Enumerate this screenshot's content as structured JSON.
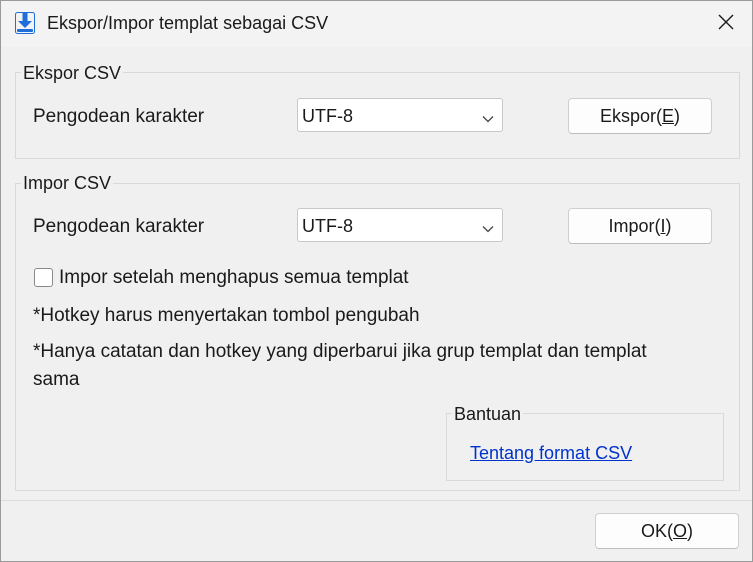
{
  "window": {
    "title": "Ekspor/Impor templat sebagai CSV"
  },
  "icons": {
    "app": "download-arrow-icon",
    "close": "close-icon",
    "dropdown": "chevron-down-icon"
  },
  "export_group": {
    "legend": "Ekspor CSV",
    "encoding_label": "Pengodean karakter",
    "encoding_value": "UTF-8",
    "button_prefix": "Ekspor(",
    "button_accel": "E",
    "button_suffix": ")"
  },
  "import_group": {
    "legend": "Impor CSV",
    "encoding_label": "Pengodean karakter",
    "encoding_value": "UTF-8",
    "button_prefix": "Impor(",
    "button_accel": "I",
    "button_suffix": ")",
    "checkbox_label": "Impor setelah menghapus semua templat",
    "checkbox_checked": false,
    "note1": "*Hotkey harus menyertakan tombol pengubah",
    "note2_line1": "*Hanya catatan dan hotkey yang diperbarui jika grup templat dan templat",
    "note2_line2": "sama"
  },
  "help_group": {
    "legend": "Bantuan",
    "link": "Tentang format CSV"
  },
  "footer": {
    "ok_prefix": "OK(",
    "ok_accel": "O",
    "ok_suffix": ")"
  },
  "colors": {
    "accent": "#1e6fd9",
    "link": "#0033cc"
  }
}
